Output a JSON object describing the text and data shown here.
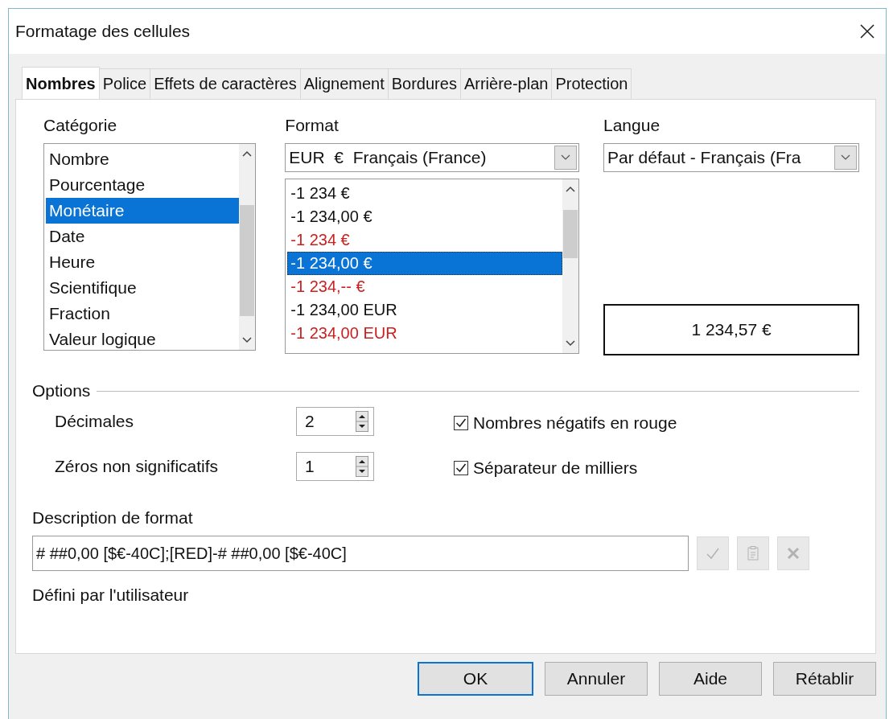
{
  "window": {
    "title": "Formatage des cellules"
  },
  "tabs": [
    {
      "label": "Nombres",
      "selected": true
    },
    {
      "label": "Police",
      "selected": false
    },
    {
      "label": "Effets de caractères",
      "selected": false
    },
    {
      "label": "Alignement",
      "selected": false
    },
    {
      "label": "Bordures",
      "selected": false
    },
    {
      "label": "Arrière-plan",
      "selected": false
    },
    {
      "label": "Protection",
      "selected": false
    }
  ],
  "category": {
    "label": "Catégorie",
    "items": [
      {
        "label": "Nombre",
        "selected": false
      },
      {
        "label": "Pourcentage",
        "selected": false
      },
      {
        "label": "Monétaire",
        "selected": true
      },
      {
        "label": "Date",
        "selected": false
      },
      {
        "label": "Heure",
        "selected": false
      },
      {
        "label": "Scientifique",
        "selected": false
      },
      {
        "label": "Fraction",
        "selected": false
      },
      {
        "label": "Valeur logique",
        "selected": false
      }
    ]
  },
  "format": {
    "label": "Format",
    "currency": "EUR  €  Français (France)",
    "items": [
      {
        "label": "-1 234 €",
        "selected": false,
        "red": false
      },
      {
        "label": "-1 234,00 €",
        "selected": false,
        "red": false
      },
      {
        "label": "-1 234 €",
        "selected": false,
        "red": true
      },
      {
        "label": "-1 234,00 €",
        "selected": true,
        "red": true
      },
      {
        "label": "-1 234,-- €",
        "selected": false,
        "red": true
      },
      {
        "label": "-1 234,00 EUR",
        "selected": false,
        "red": false
      },
      {
        "label": "-1 234,00 EUR",
        "selected": false,
        "red": true
      }
    ]
  },
  "language": {
    "label": "Langue",
    "value": "Par défaut - Français (Fra"
  },
  "preview": "1 234,57 €",
  "options": {
    "label": "Options",
    "fields": [
      {
        "label": "Décimales",
        "value": "2"
      },
      {
        "label": "Zéros non significatifs",
        "value": "1"
      }
    ],
    "checkboxes": [
      {
        "label": "Nombres négatifs en rouge",
        "checked": true
      },
      {
        "label": "Séparateur de milliers",
        "checked": true
      }
    ]
  },
  "format_code": {
    "label": "Description de format",
    "value": "# ##0,00 [$€-40C];[RED]-# ##0,00 [$€-40C]",
    "tools": [
      {
        "kind": "check",
        "disabled": true
      },
      {
        "kind": "note",
        "disabled": true
      },
      {
        "kind": "delete",
        "disabled": true
      }
    ]
  },
  "description": "Défini par l'utilisateur",
  "buttons": [
    {
      "label": "OK",
      "default": true
    },
    {
      "label": "Annuler",
      "default": false
    },
    {
      "label": "Aide",
      "default": false
    },
    {
      "label": "Rétablir",
      "default": false
    }
  ]
}
